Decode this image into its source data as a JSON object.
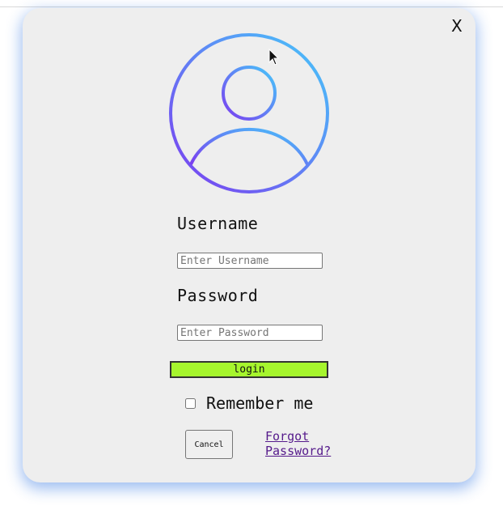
{
  "dialog": {
    "close_label": "X",
    "icon": "user-avatar-icon",
    "gradient_colors": [
      "#46c8fa",
      "#7b3cf0"
    ]
  },
  "form": {
    "username_label": "Username",
    "username_placeholder": "Enter Username",
    "username_value": "",
    "password_label": "Password",
    "password_placeholder": "Enter Password",
    "password_value": "",
    "login_label": "login",
    "login_color": "#a6f52d",
    "remember_label": "Remember me",
    "remember_checked": false,
    "cancel_label": "Cancel",
    "forgot_label": "Forgot Password?"
  }
}
